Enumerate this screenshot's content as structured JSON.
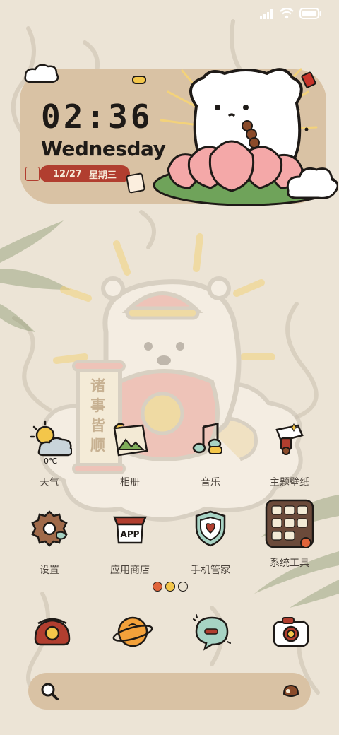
{
  "clock": {
    "time": "02:36",
    "weekday": "Wednesday",
    "date": "12/27",
    "lunar": "星期三"
  },
  "scroll_text": "诸事皆顺",
  "apps_row1": [
    {
      "label": "天气",
      "icon": "weather-icon",
      "extra": "0℃"
    },
    {
      "label": "相册",
      "icon": "gallery-icon"
    },
    {
      "label": "音乐",
      "icon": "music-icon"
    },
    {
      "label": "主题壁纸",
      "icon": "themes-icon"
    }
  ],
  "apps_row2": [
    {
      "label": "设置",
      "icon": "settings-icon"
    },
    {
      "label": "应用商店",
      "icon": "app-store-icon",
      "badge": "APP"
    },
    {
      "label": "手机管家",
      "icon": "security-icon"
    },
    {
      "label": "系统工具",
      "icon": "system-tools-folder-icon"
    }
  ],
  "dock": [
    "phone-icon",
    "browser-icon",
    "messages-icon",
    "camera-icon"
  ],
  "colors": {
    "background": "#ece4d6",
    "widget": "#d9c2a4",
    "accent_red": "#b13e2f"
  }
}
